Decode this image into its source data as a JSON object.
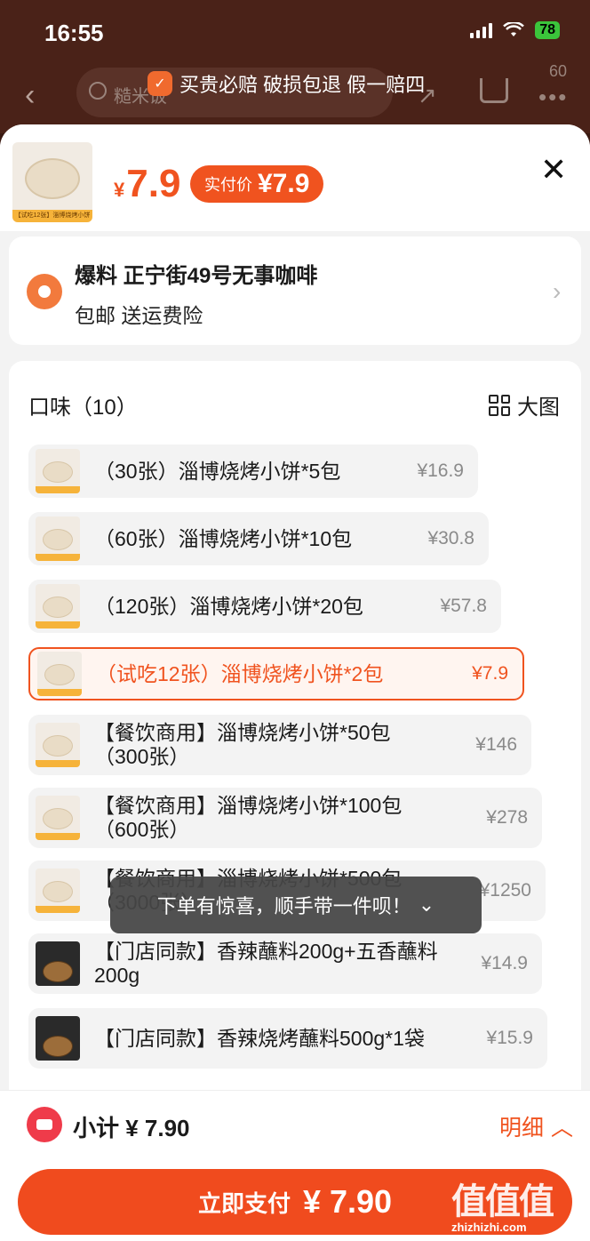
{
  "status": {
    "time": "16:55",
    "battery": "78"
  },
  "header": {
    "search_hint": "糙米饭",
    "guarantee": "买贵必赔 破损包退 假一赔四",
    "more_count": "60"
  },
  "product": {
    "thumb_strip": "【试吃12张】淄博烧烤小饼*2包",
    "price_symbol": "¥",
    "price": "7.9",
    "paid_label": "实付价",
    "paid_amount": "¥7.9"
  },
  "address": {
    "title": "爆料 正宁街49号无事咖啡",
    "sub": "包邮  送运费险"
  },
  "options": {
    "title": "口味（10）",
    "big_view": "大图",
    "items": [
      {
        "name": "（30张）淄博烧烤小饼*5包",
        "price": "¥16.9"
      },
      {
        "name": "（60张）淄博烧烤小饼*10包",
        "price": "¥30.8"
      },
      {
        "name": "（120张）淄博烧烤小饼*20包",
        "price": "¥57.8"
      },
      {
        "name": "（试吃12张）淄博烧烤小饼*2包",
        "price": "¥7.9",
        "selected": true
      },
      {
        "name": "【餐饮商用】淄博烧烤小饼*50包（300张）",
        "price": "¥146"
      },
      {
        "name": "【餐饮商用】淄博烧烤小饼*100包（600张）",
        "price": "¥278"
      },
      {
        "name": "【餐饮商用】淄博烧烤小饼*500包（3000张）",
        "price": "¥1250"
      },
      {
        "name": "【门店同款】香辣蘸料200g+五香蘸料200g",
        "price": "¥14.9"
      },
      {
        "name": "【门店同款】香辣烧烤蘸料500g*1袋",
        "price": "¥15.9"
      }
    ]
  },
  "toast": "下单有惊喜，顺手带一件呗！",
  "footer": {
    "subtotal": "小计 ¥ 7.90",
    "detail": "明细",
    "pay_label": "立即支付",
    "pay_amount": "¥ 7.90",
    "watermark": "值值值",
    "watermark_url": "zhizhizhi.com"
  }
}
